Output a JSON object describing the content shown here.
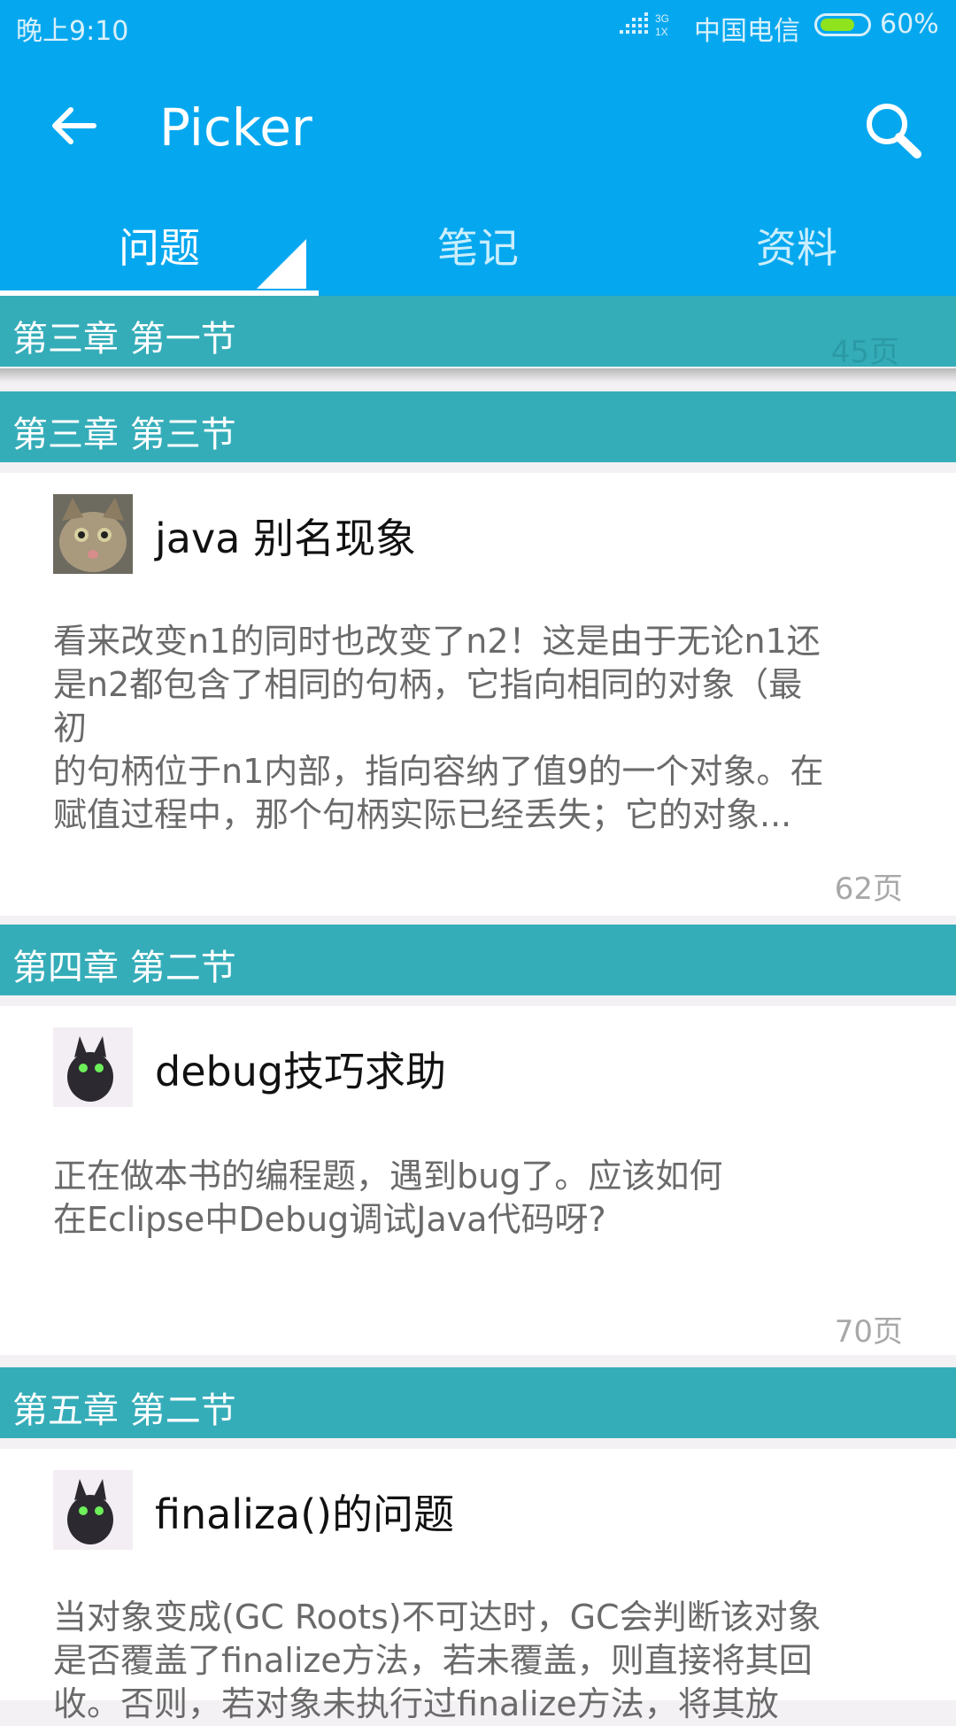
{
  "status_bar": {
    "time": "晚上9:10",
    "network": "3G 1X",
    "carrier": "中国电信",
    "battery": "60%"
  },
  "app_bar": {
    "title": "Picker",
    "back_icon": "arrow-left-icon",
    "search_icon": "search-icon"
  },
  "tabs": [
    {
      "label": "问题",
      "selected": true
    },
    {
      "label": "笔记",
      "selected": false
    },
    {
      "label": "资料",
      "selected": false
    }
  ],
  "sections": [
    {
      "header": "第三章 第一节",
      "page_hint": "45页"
    },
    {
      "header": "第三章 第三节"
    },
    {
      "header": "第四章 第二节"
    },
    {
      "header": "第五章 第二节"
    }
  ],
  "cards": [
    {
      "title": "java 别名现象",
      "body_lines": [
        "看来改变n1的同时也改变了n2！这是由于无论n1还",
        "是n2都包含了相同的句柄，它指向相同的对象（最",
        "初",
        "的句柄位于n1内部，指向容纳了值9的一个对象。在",
        "赋值过程中，那个句柄实际已经丢失；它的对象..."
      ],
      "page": "62页",
      "avatar_icon": "cat-avatar-icon"
    },
    {
      "title": "debug技巧求助",
      "body_lines": [
        "正在做本书的编程题，遇到bug了。应该如何",
        "在Eclipse中Debug调试Java代码呀?"
      ],
      "page": "70页",
      "avatar_icon": "creature-avatar-icon"
    },
    {
      "title": "finaliza()的问题",
      "body_lines": [
        "当对象变成(GC Roots)不可达时，GC会判断该对象",
        "是否覆盖了finalize方法，若未覆盖，则直接将其回",
        "收。否则，若对象未执行过finalize方法，将其放"
      ],
      "avatar_icon": "creature-avatar-icon"
    }
  ],
  "colors": {
    "app_bar": "#05a8ef",
    "section_header": "#35adb9"
  }
}
